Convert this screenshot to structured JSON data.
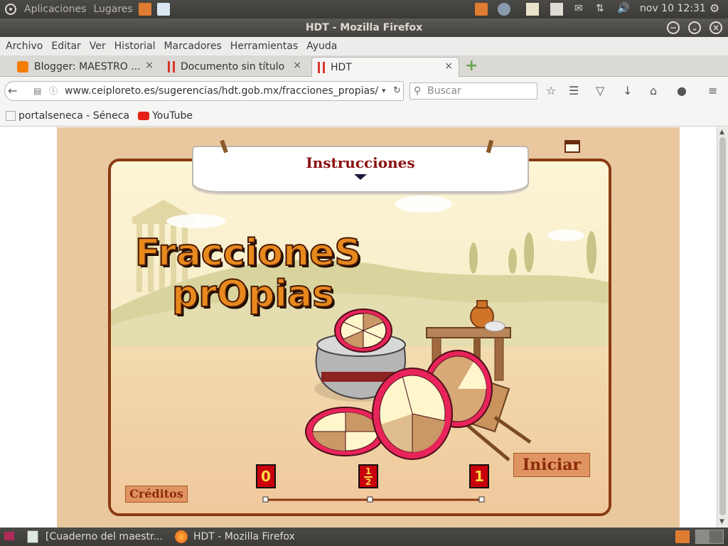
{
  "system": {
    "applications": "Aplicaciones",
    "places": "Lugares",
    "clock": "nov 10 12:31"
  },
  "window": {
    "title": "HDT - Mozilla Firefox"
  },
  "menu": [
    "Archivo",
    "Editar",
    "Ver",
    "Historial",
    "Marcadores",
    "Herramientas",
    "Ayuda"
  ],
  "tabs": [
    {
      "label": "Blogger: MAESTRO ...",
      "close": "×"
    },
    {
      "label": "Documento sin título",
      "close": "×"
    },
    {
      "label": "HDT",
      "close": "×"
    }
  ],
  "nav": {
    "url": "www.ceiploreto.es/sugerencias/hdt.gob.mx/fracciones_propias/",
    "search_placeholder": "Buscar"
  },
  "bookmarks": [
    "portalseneca - Séneca",
    "YouTube"
  ],
  "game": {
    "instructions_title": "Instrucciones",
    "title_line1": "FraccioneS",
    "title_line2": "prOpias",
    "start_button": "Iniciar",
    "credits_button": "Créditos",
    "scale_labels": {
      "zero": "0",
      "half_num": "1",
      "half_den": "2",
      "one": "1"
    }
  },
  "taskbar": {
    "items": [
      "[Cuaderno del maestr...",
      "HDT - Mozilla Firefox"
    ]
  },
  "colors": {
    "frame": "#8b3a12",
    "title_orange": "#e8891d",
    "label_red": "#c8000b"
  }
}
